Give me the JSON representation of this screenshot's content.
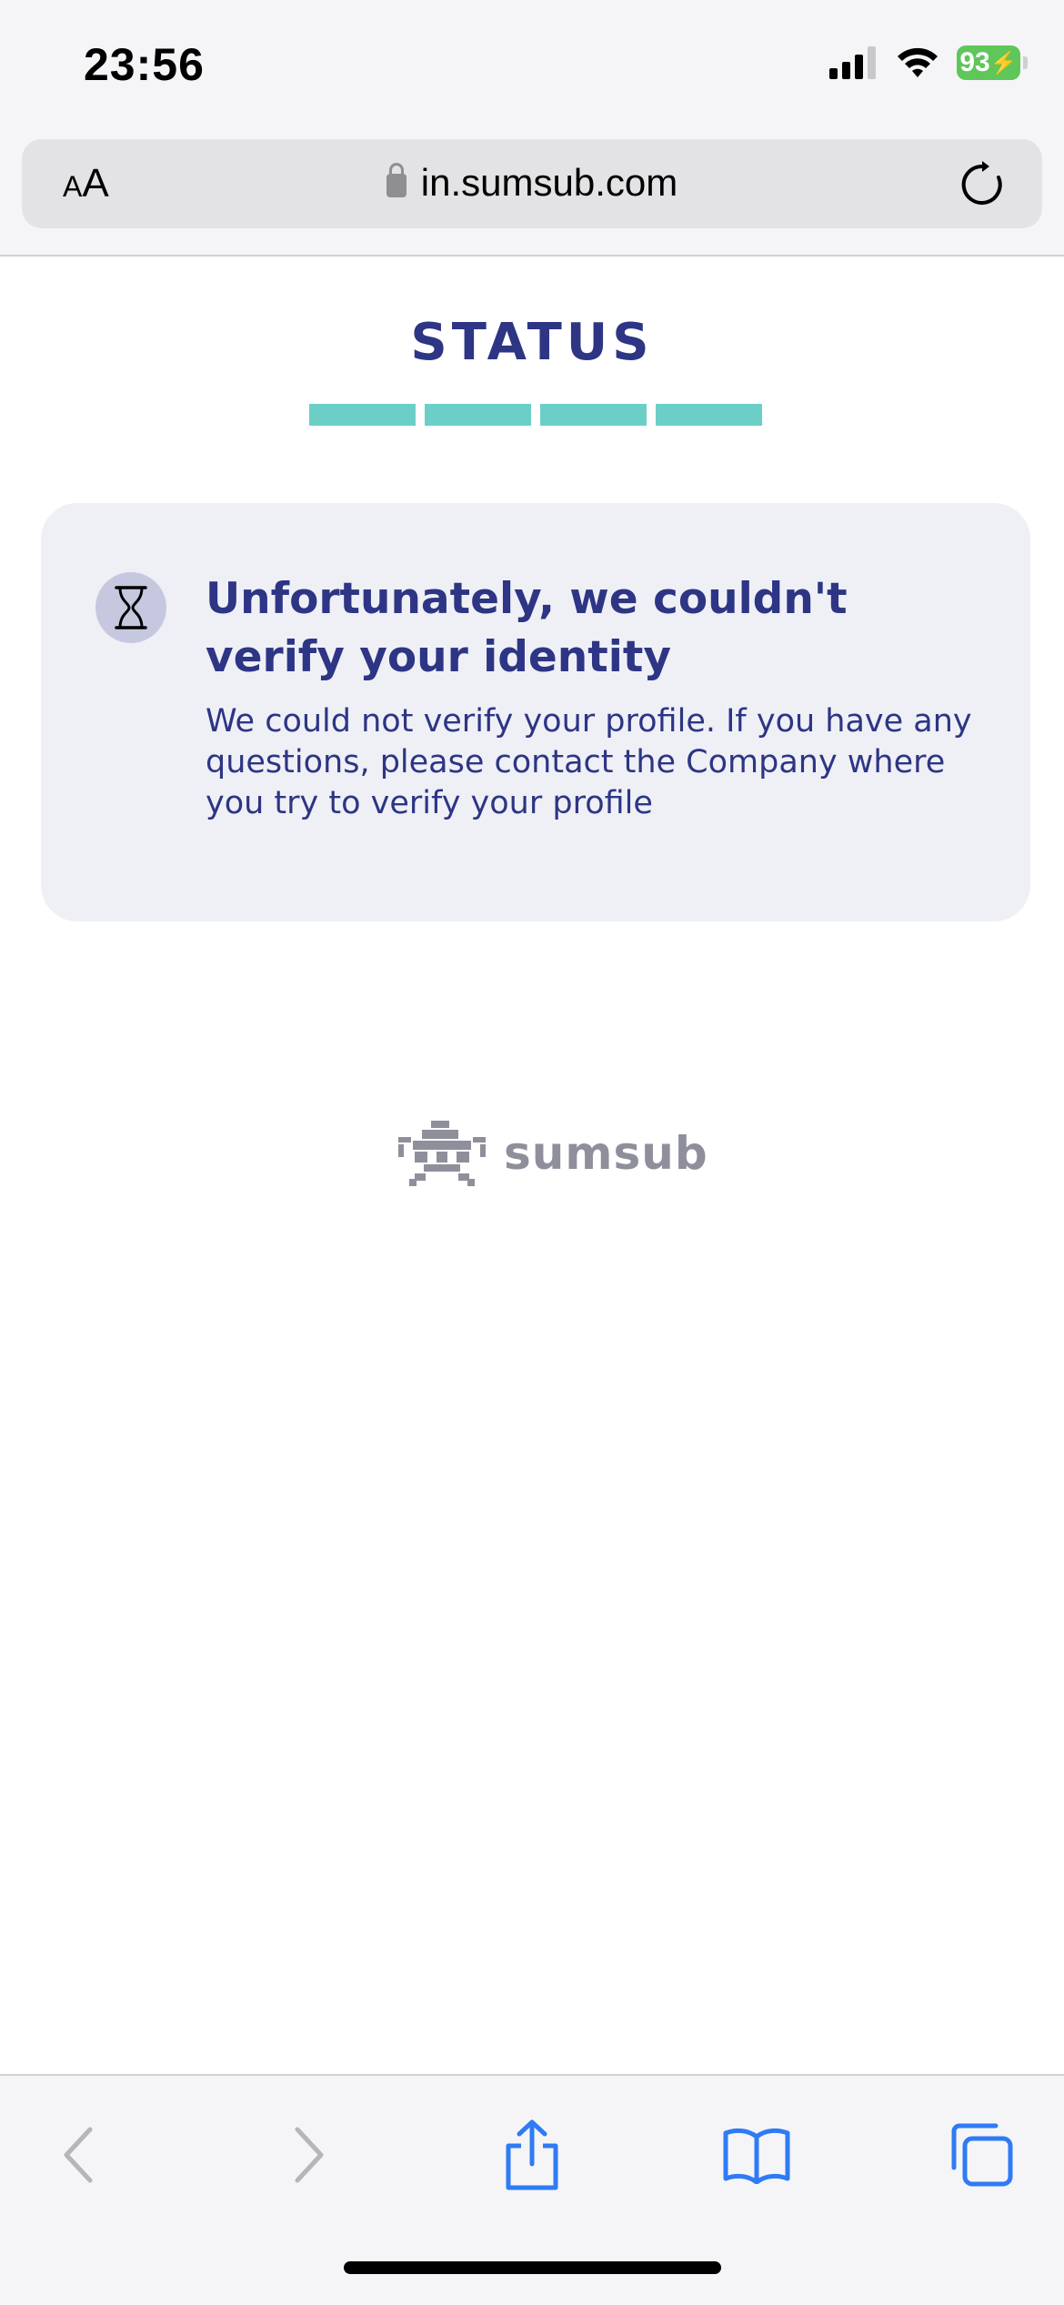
{
  "status_bar": {
    "time": "23:56",
    "battery": "93"
  },
  "browser": {
    "url": "in.sumsub.com",
    "text_size_label": "AA"
  },
  "page": {
    "title": "STATUS",
    "progress_steps": 4,
    "card": {
      "icon": "hourglass-icon",
      "heading": "Unfortunately, we couldn't verify your identity",
      "message": "We could not verify your profile. If you have any questions, please contact the Company where you try to verify your profile"
    },
    "brand": "sumsub"
  },
  "toolbar": {
    "items": [
      "back-icon",
      "forward-icon",
      "share-icon",
      "bookmarks-icon",
      "tabs-icon"
    ]
  },
  "colors": {
    "accent": "#2d3584",
    "progress": "#6ccfc7",
    "card_bg": "#eff0f6"
  }
}
